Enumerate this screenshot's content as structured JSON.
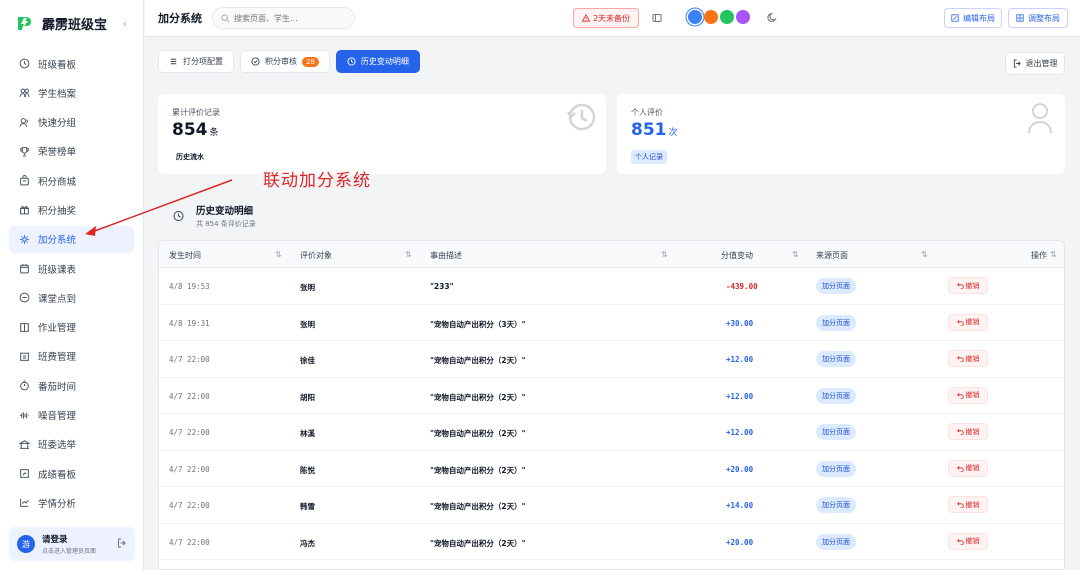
{
  "brand": {
    "name": "霹雳班级宝"
  },
  "sidebar": {
    "items": [
      {
        "label": "班级看板",
        "icon": "clock-icon"
      },
      {
        "label": "学生档案",
        "icon": "users-icon"
      },
      {
        "label": "快速分组",
        "icon": "group-icon"
      },
      {
        "label": "荣誉榜单",
        "icon": "trophy-icon"
      },
      {
        "label": "积分商城",
        "icon": "shop-icon"
      },
      {
        "label": "积分抽奖",
        "icon": "gift-icon"
      },
      {
        "label": "加分系统",
        "icon": "gear-icon",
        "active": true
      },
      {
        "label": "班级课表",
        "icon": "calendar-icon"
      },
      {
        "label": "课堂点到",
        "icon": "check-icon"
      },
      {
        "label": "作业管理",
        "icon": "book-icon"
      },
      {
        "label": "班费管理",
        "icon": "wallet-icon"
      },
      {
        "label": "番茄时间",
        "icon": "timer-icon"
      },
      {
        "label": "噪音管理",
        "icon": "noise-icon"
      },
      {
        "label": "班委选举",
        "icon": "vote-icon"
      },
      {
        "label": "成绩看板",
        "icon": "score-icon"
      },
      {
        "label": "学情分析",
        "icon": "chart-icon"
      }
    ],
    "login": {
      "avatar": "游",
      "title": "请登录",
      "subtitle": "点击进入管理员页面"
    }
  },
  "topbar": {
    "title": "加分系统",
    "search_placeholder": "搜索页面、学生...",
    "backup": "2天未备份",
    "edit_layout": "编辑布局",
    "adjust_layout": "调整布局",
    "theme_colors": [
      "#3b82f6",
      "#f97316",
      "#22c55e",
      "#a855f7"
    ]
  },
  "tabs": [
    {
      "label": "打分项配置"
    },
    {
      "label": "积分审核",
      "badge": "28"
    },
    {
      "label": "历史变动明细",
      "active": true
    }
  ],
  "exit_label": "退出管理",
  "stats": {
    "total": {
      "label": "累计评价记录",
      "value": "854",
      "unit": "条",
      "tag": "历史流水"
    },
    "personal": {
      "label": "个人评价",
      "value": "851",
      "unit": "次",
      "tag": "个人记录"
    }
  },
  "annotation": "联动加分系统",
  "section": {
    "title": "历史变动明细",
    "subtitle": "共 854 条评价记录"
  },
  "table": {
    "headers": [
      "发生时间",
      "评价对象",
      "事由描述",
      "分值变动",
      "来源页面",
      "操作"
    ],
    "rows": [
      {
        "time": "4/8 19:53",
        "name": "张明",
        "desc": "\"233\"",
        "value": "-439.00",
        "source": "加分页面",
        "action": "撤销"
      },
      {
        "time": "4/8 19:31",
        "name": "张明",
        "desc": "\"宠物自动产出积分（3天）\"",
        "value": "+30.00",
        "source": "加分页面",
        "action": "撤销"
      },
      {
        "time": "4/7 22:00",
        "name": "徐佳",
        "desc": "\"宠物自动产出积分（2天）\"",
        "value": "+12.00",
        "source": "加分页面",
        "action": "撤销"
      },
      {
        "time": "4/7 22:00",
        "name": "胡阳",
        "desc": "\"宠物自动产出积分（2天）\"",
        "value": "+12.00",
        "source": "加分页面",
        "action": "撤销"
      },
      {
        "time": "4/7 22:00",
        "name": "林溪",
        "desc": "\"宠物自动产出积分（2天）\"",
        "value": "+12.00",
        "source": "加分页面",
        "action": "撤销"
      },
      {
        "time": "4/7 22:00",
        "name": "陈悦",
        "desc": "\"宠物自动产出积分（2天）\"",
        "value": "+20.00",
        "source": "加分页面",
        "action": "撤销"
      },
      {
        "time": "4/7 22:00",
        "name": "韩雪",
        "desc": "\"宠物自动产出积分（2天）\"",
        "value": "+14.00",
        "source": "加分页面",
        "action": "撤销"
      },
      {
        "time": "4/7 22:00",
        "name": "冯杰",
        "desc": "\"宠物自动产出积分（2天）\"",
        "value": "+20.00",
        "source": "加分页面",
        "action": "撤销"
      }
    ]
  },
  "colors": {
    "accent": "#2563eb",
    "negative": "#dc2626",
    "positive": "#2563eb"
  }
}
